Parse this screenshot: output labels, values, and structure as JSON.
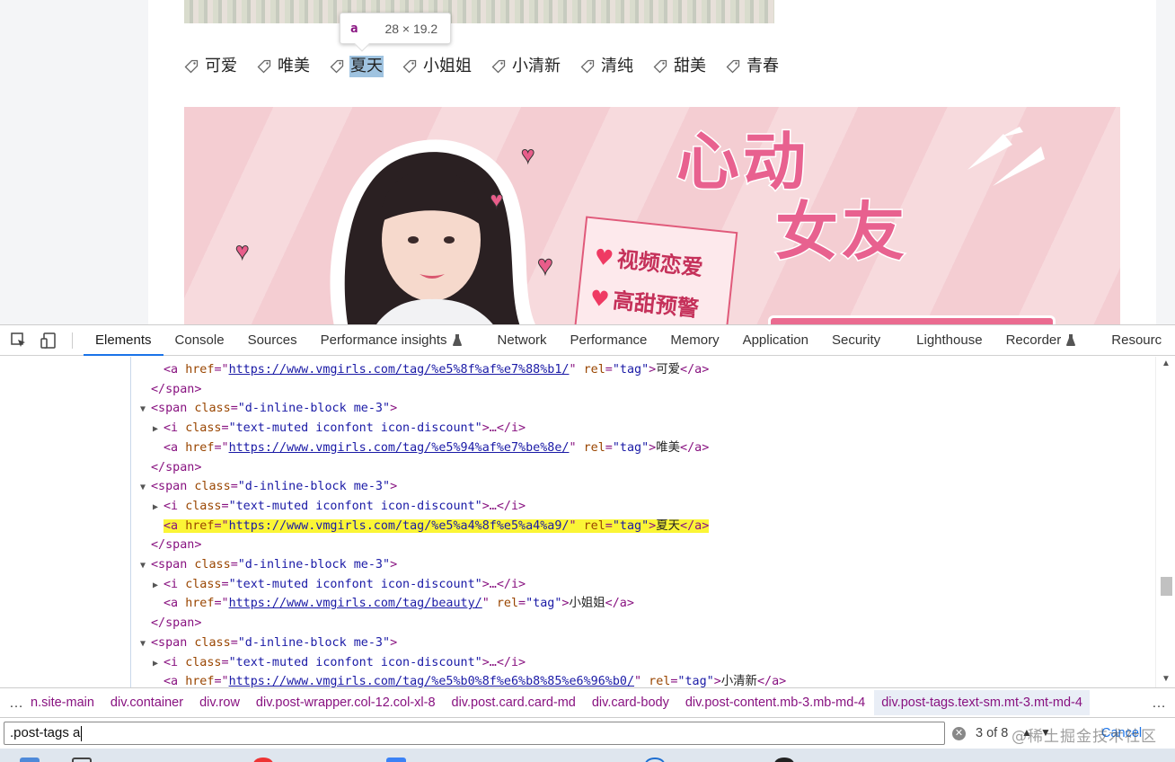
{
  "page": {
    "tags": [
      {
        "label": "可爱",
        "inspected": false
      },
      {
        "label": "唯美",
        "inspected": false
      },
      {
        "label": "夏天",
        "inspected": true
      },
      {
        "label": "小姐姐",
        "inspected": false
      },
      {
        "label": "小清新",
        "inspected": false
      },
      {
        "label": "清纯",
        "inspected": false
      },
      {
        "label": "甜美",
        "inspected": false
      },
      {
        "label": "青春",
        "inspected": false
      }
    ],
    "tooltip": {
      "tag": "a",
      "size": "28 × 19.2"
    },
    "banner": {
      "title_line1": "心动",
      "title_line2": "女友",
      "note_line1": "视频恋爱",
      "note_line2": "高甜预警"
    }
  },
  "devtools": {
    "tabs": [
      {
        "label": "Elements",
        "active": true,
        "experimental": false
      },
      {
        "label": "Console",
        "active": false,
        "experimental": false
      },
      {
        "label": "Sources",
        "active": false,
        "experimental": false
      },
      {
        "label": "Performance insights",
        "active": false,
        "experimental": true
      },
      {
        "label": "Network",
        "active": false,
        "experimental": false
      },
      {
        "label": "Performance",
        "active": false,
        "experimental": false
      },
      {
        "label": "Memory",
        "active": false,
        "experimental": false
      },
      {
        "label": "Application",
        "active": false,
        "experimental": false
      },
      {
        "label": "Security",
        "active": false,
        "experimental": false
      },
      {
        "label": "Lighthouse",
        "active": false,
        "experimental": false
      },
      {
        "label": "Recorder",
        "active": false,
        "experimental": true
      },
      {
        "label": "Resourc",
        "active": false,
        "experimental": false
      }
    ],
    "dom_lines": [
      {
        "indent": 2,
        "kind": "a",
        "href": "https://www.vmgirls.com/tag/%e5%8f%af%e7%88%b1/",
        "text": "可爱",
        "highlight": false
      },
      {
        "indent": 1,
        "kind": "close",
        "tag": "span"
      },
      {
        "indent": 1,
        "kind": "span",
        "class": "d-inline-block me-3"
      },
      {
        "indent": 2,
        "kind": "i",
        "class": "text-muted iconfont icon-discount"
      },
      {
        "indent": 2,
        "kind": "a",
        "href": "https://www.vmgirls.com/tag/%e5%94%af%e7%be%8e/",
        "text": "唯美",
        "highlight": false
      },
      {
        "indent": 1,
        "kind": "close",
        "tag": "span"
      },
      {
        "indent": 1,
        "kind": "span",
        "class": "d-inline-block me-3"
      },
      {
        "indent": 2,
        "kind": "i",
        "class": "text-muted iconfont icon-discount"
      },
      {
        "indent": 2,
        "kind": "a",
        "href": "https://www.vmgirls.com/tag/%e5%a4%8f%e5%a4%a9/",
        "text": "夏天",
        "highlight": true
      },
      {
        "indent": 1,
        "kind": "close",
        "tag": "span"
      },
      {
        "indent": 1,
        "kind": "span",
        "class": "d-inline-block me-3"
      },
      {
        "indent": 2,
        "kind": "i",
        "class": "text-muted iconfont icon-discount"
      },
      {
        "indent": 2,
        "kind": "a",
        "href": "https://www.vmgirls.com/tag/beauty/",
        "text": "小姐姐",
        "highlight": false
      },
      {
        "indent": 1,
        "kind": "close",
        "tag": "span"
      },
      {
        "indent": 1,
        "kind": "span",
        "class": "d-inline-block me-3"
      },
      {
        "indent": 2,
        "kind": "i",
        "class": "text-muted iconfont icon-discount"
      },
      {
        "indent": 2,
        "kind": "a",
        "href": "https://www.vmgirls.com/tag/%e5%b0%8f%e6%b8%85%e6%96%b0/",
        "text": "小清新",
        "highlight": false
      }
    ],
    "breadcrumbs": [
      "n.site-main",
      "div.container",
      "div.row",
      "div.post-wrapper.col-12.col-xl-8",
      "div.post.card.card-md",
      "div.card-body",
      "div.post-content.mb-3.mb-md-4",
      "div.post-tags.text-sm.mt-3.mt-md-4"
    ],
    "breadcrumb_ellipsis": "…",
    "search": {
      "value": ".post-tags a",
      "match_count": "3 of 8",
      "cancel_label": "Cancel",
      "clear_glyph": "✕",
      "up_glyph": "▲",
      "down_glyph": "▼"
    },
    "watermark": "@稀土掘金技术社区"
  },
  "colors": {
    "active_tab_underline": "#1a73e8",
    "highlight_line": "#fbf536",
    "inspected_tag_bg": "#9fc3e0",
    "banner_bg": "#f4cdd2",
    "dom_tag": "#881280",
    "dom_attr": "#994500",
    "dom_value": "#1a1aa6"
  }
}
